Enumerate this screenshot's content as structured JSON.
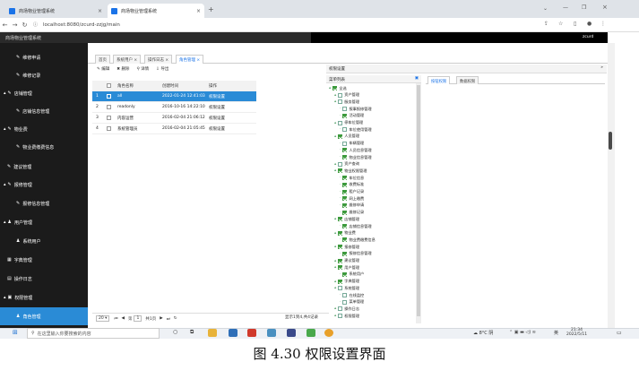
{
  "browser": {
    "tabs": [
      {
        "label": "商场物业管理系统"
      },
      {
        "label": "商场物业管理系统"
      }
    ],
    "url": "localhost:8080/zcurd-zzjg/main"
  },
  "app": {
    "title": "商场物业管理系统",
    "user": "zcurd",
    "sidebar": [
      {
        "label": "维修申请"
      },
      {
        "label": "维修记录"
      },
      {
        "label": "店铺管理"
      },
      {
        "label": "店铺信息管理"
      },
      {
        "label": "物业费"
      },
      {
        "label": "物业费缴费信息"
      },
      {
        "label": "建议管理"
      },
      {
        "label": "报修管理"
      },
      {
        "label": "报修信息管理"
      },
      {
        "label": "用户管理"
      },
      {
        "label": "系统用户"
      },
      {
        "label": "字典管理"
      },
      {
        "label": "操作日志"
      },
      {
        "label": "权限管理"
      },
      {
        "label": "角色管理"
      }
    ],
    "page_tabs": [
      {
        "label": "首页"
      },
      {
        "label": "系统用户 ×"
      },
      {
        "label": "操作日志 ×"
      },
      {
        "label": "角色管理 ×"
      }
    ],
    "toolbar": {
      "edit": "编辑",
      "delete": "删除",
      "detail": "详情",
      "export": "导出"
    },
    "grid": {
      "headers": [
        "角色名称",
        "创建时间",
        "操作"
      ],
      "rows": [
        {
          "num": "1",
          "name": "all",
          "time": "2022-01-24 12:41:03",
          "op": "权限设置"
        },
        {
          "num": "2",
          "name": "readonly",
          "time": "2016-10-16 14:22:10",
          "op": "权限设置"
        },
        {
          "num": "3",
          "name": "内容运营",
          "time": "2016-02-04 21:06:12",
          "op": "权限设置"
        },
        {
          "num": "4",
          "name": "系统管理员",
          "time": "2016-02-04 21:05:45",
          "op": "权限设置"
        }
      ],
      "pager": {
        "size": "20",
        "page": "1",
        "total_pages": "共1页",
        "info": "显示1到4,共4记录"
      }
    },
    "perm": {
      "title": "权限设置",
      "tree_title": "菜单列表",
      "right_tabs": [
        {
          "label": "按钮权限"
        },
        {
          "label": "数据权限"
        }
      ],
      "tree": [
        {
          "label": "全选",
          "checked": true,
          "level": 0
        },
        {
          "label": "资产管理",
          "checked": false,
          "level": 1
        },
        {
          "label": "服务管理",
          "checked": false,
          "level": 1
        },
        {
          "label": "报事报修管理",
          "checked": false,
          "level": 2
        },
        {
          "label": "活动管理",
          "checked": true,
          "level": 2
        },
        {
          "label": "停车位管理",
          "checked": false,
          "level": 1
        },
        {
          "label": "车位使用管理",
          "checked": false,
          "level": 2
        },
        {
          "label": "人员管理",
          "checked": true,
          "level": 1
        },
        {
          "label": "车辆管理",
          "checked": false,
          "level": 2
        },
        {
          "label": "人员信息管理",
          "checked": true,
          "level": 2
        },
        {
          "label": "物业信息管理",
          "checked": true,
          "level": 2
        },
        {
          "label": "资产查询",
          "checked": false,
          "level": 1
        },
        {
          "label": "物业权限管理",
          "checked": true,
          "level": 1
        },
        {
          "label": "车位信息",
          "checked": true,
          "level": 2
        },
        {
          "label": "收费标准",
          "checked": true,
          "level": 2
        },
        {
          "label": "租户记录",
          "checked": true,
          "level": 2
        },
        {
          "label": "网上缴费",
          "checked": true,
          "level": 2
        },
        {
          "label": "维修申请",
          "checked": true,
          "level": 2
        },
        {
          "label": "维修记录",
          "checked": true,
          "level": 2
        },
        {
          "label": "店铺管理",
          "checked": true,
          "level": 1
        },
        {
          "label": "店铺信息管理",
          "checked": true,
          "level": 2
        },
        {
          "label": "物业费",
          "checked": true,
          "level": 1
        },
        {
          "label": "物业费缴费信息",
          "checked": true,
          "level": 2
        },
        {
          "label": "报修管理",
          "checked": true,
          "level": 1
        },
        {
          "label": "报修信息管理",
          "checked": true,
          "level": 2
        },
        {
          "label": "建议管理",
          "checked": true,
          "level": 1
        },
        {
          "label": "用户管理",
          "checked": true,
          "level": 1
        },
        {
          "label": "系统用户",
          "checked": true,
          "level": 2
        },
        {
          "label": "字典管理",
          "checked": true,
          "level": 1
        },
        {
          "label": "系统管理",
          "checked": false,
          "level": 1
        },
        {
          "label": "在线监控",
          "checked": false,
          "level": 2
        },
        {
          "label": "菜单管理",
          "checked": false,
          "level": 2
        },
        {
          "label": "操作日志",
          "checked": false,
          "level": 1
        },
        {
          "label": "权限管理",
          "checked": false,
          "level": 1
        }
      ]
    }
  },
  "taskbar": {
    "search": "在这里输入你要搜索的内容",
    "weather": "8°C 阴",
    "time": "21:34",
    "date": "2022/5/11",
    "ime": "英"
  },
  "caption": "图 4.30 权限设置界面"
}
